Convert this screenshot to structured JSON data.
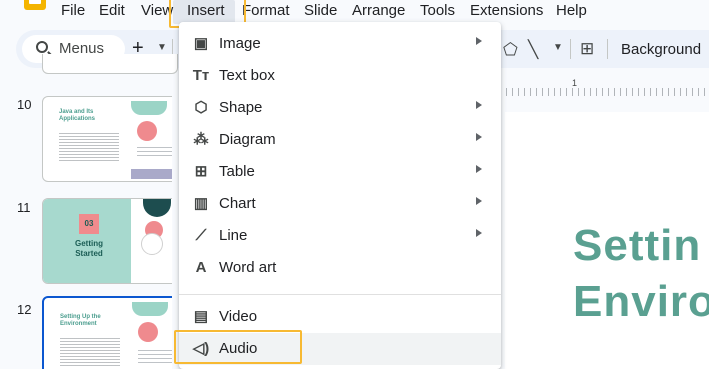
{
  "menubar": {
    "items": [
      "File",
      "Edit",
      "View",
      "Insert",
      "Format",
      "Slide",
      "Arrange",
      "Tools",
      "Extensions",
      "Help"
    ],
    "active": "Insert"
  },
  "toolbar": {
    "search_label": "Menus",
    "add_icon": "+",
    "background_label": "Background"
  },
  "filmstrip": {
    "slides": [
      {
        "number": "10",
        "title": "Java and Its Applications"
      },
      {
        "number": "11",
        "badge": "03",
        "title": "Getting Started"
      },
      {
        "number": "12",
        "title": "Setting Up the Environment"
      }
    ]
  },
  "ruler": {
    "mark": "1"
  },
  "canvas": {
    "heading_line1": "Settin",
    "heading_line2": "Enviro",
    "accent_color": "#5aa091"
  },
  "insert_menu": {
    "items": [
      {
        "label": "Image",
        "icon": "image-icon",
        "submenu": true
      },
      {
        "label": "Text box",
        "icon": "text-box-icon",
        "submenu": false
      },
      {
        "label": "Shape",
        "icon": "shape-icon",
        "submenu": true
      },
      {
        "label": "Diagram",
        "icon": "diagram-icon",
        "submenu": true
      },
      {
        "label": "Table",
        "icon": "table-icon",
        "submenu": true
      },
      {
        "label": "Chart",
        "icon": "chart-icon",
        "submenu": true
      },
      {
        "label": "Line",
        "icon": "line-icon",
        "submenu": true
      },
      {
        "label": "Word art",
        "icon": "word-art-icon",
        "submenu": false
      },
      {
        "label": "Video",
        "icon": "video-icon",
        "submenu": false
      },
      {
        "label": "Audio",
        "icon": "audio-icon",
        "submenu": false
      }
    ],
    "highlight_color": "#f7b932"
  }
}
